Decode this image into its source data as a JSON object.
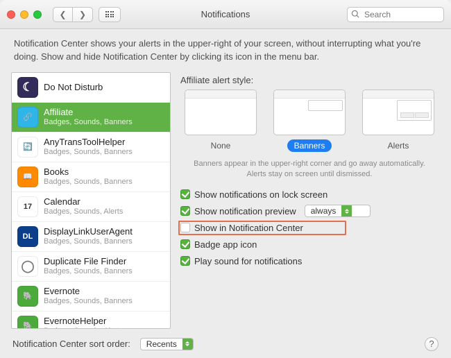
{
  "title": "Notifications",
  "search": {
    "placeholder": "Search"
  },
  "description": "Notification Center shows your alerts in the upper-right of your screen, without interrupting what you're doing. Show and hide Notification Center by clicking its icon in the menu bar.",
  "sidebar": {
    "items": [
      {
        "label": "Do Not Disturb",
        "sub": "",
        "icon": {
          "bg": "#332b5a",
          "emoji": "☾",
          "fg": "#ffffff"
        }
      },
      {
        "label": "Affiliate",
        "sub": "Badges, Sounds, Banners",
        "icon": {
          "bg": "#2fb5e8",
          "emoji": "🔗",
          "fg": "#ffffff"
        },
        "selected": true
      },
      {
        "label": "AnyTransToolHelper",
        "sub": "Badges, Sounds, Banners",
        "icon": {
          "bg": "#ffffff",
          "emoji": "🔄",
          "fg": "#2d88d8"
        }
      },
      {
        "label": "Books",
        "sub": "Badges, Sounds, Banners",
        "icon": {
          "bg": "#ff8a00",
          "emoji": "📖",
          "fg": "#ffffff"
        }
      },
      {
        "label": "Calendar",
        "sub": "Badges, Sounds, Alerts",
        "icon": {
          "bg": "#ffffff",
          "emoji": "17",
          "fg": "#333333"
        }
      },
      {
        "label": "DisplayLinkUserAgent",
        "sub": "Badges, Sounds, Banners",
        "icon": {
          "bg": "#0c3f8a",
          "emoji": "DL",
          "fg": "#ffffff"
        }
      },
      {
        "label": "Duplicate File Finder",
        "sub": "Badges, Sounds, Banners",
        "icon": {
          "bg": "#ffffff",
          "emoji": "◯",
          "fg": "#7a7a7a"
        }
      },
      {
        "label": "Evernote",
        "sub": "Badges, Sounds, Banners",
        "icon": {
          "bg": "#4caa3c",
          "emoji": "🐘",
          "fg": "#ffffff"
        }
      },
      {
        "label": "EvernoteHelper",
        "sub": "Badges, Sounds, Alerts",
        "icon": {
          "bg": "#4caa3c",
          "emoji": "🐘",
          "fg": "#ffffff"
        }
      }
    ]
  },
  "detail": {
    "header": "Affiliate alert style:",
    "styles": {
      "none": "None",
      "banners": "Banners",
      "alerts": "Alerts",
      "selected": "banners"
    },
    "hint": "Banners appear in the upper-right corner and go away automatically. Alerts stay on screen until dismissed.",
    "options": {
      "lock_screen": {
        "label": "Show notifications on lock screen",
        "checked": true
      },
      "preview": {
        "label": "Show notification preview",
        "checked": true
      },
      "preview_select": "always",
      "in_nc": {
        "label": "Show in Notification Center",
        "checked": false
      },
      "badge": {
        "label": "Badge app icon",
        "checked": true
      },
      "sound": {
        "label": "Play sound for notifications",
        "checked": true
      }
    }
  },
  "footer": {
    "label": "Notification Center sort order:",
    "select": "Recents",
    "help": "?"
  }
}
